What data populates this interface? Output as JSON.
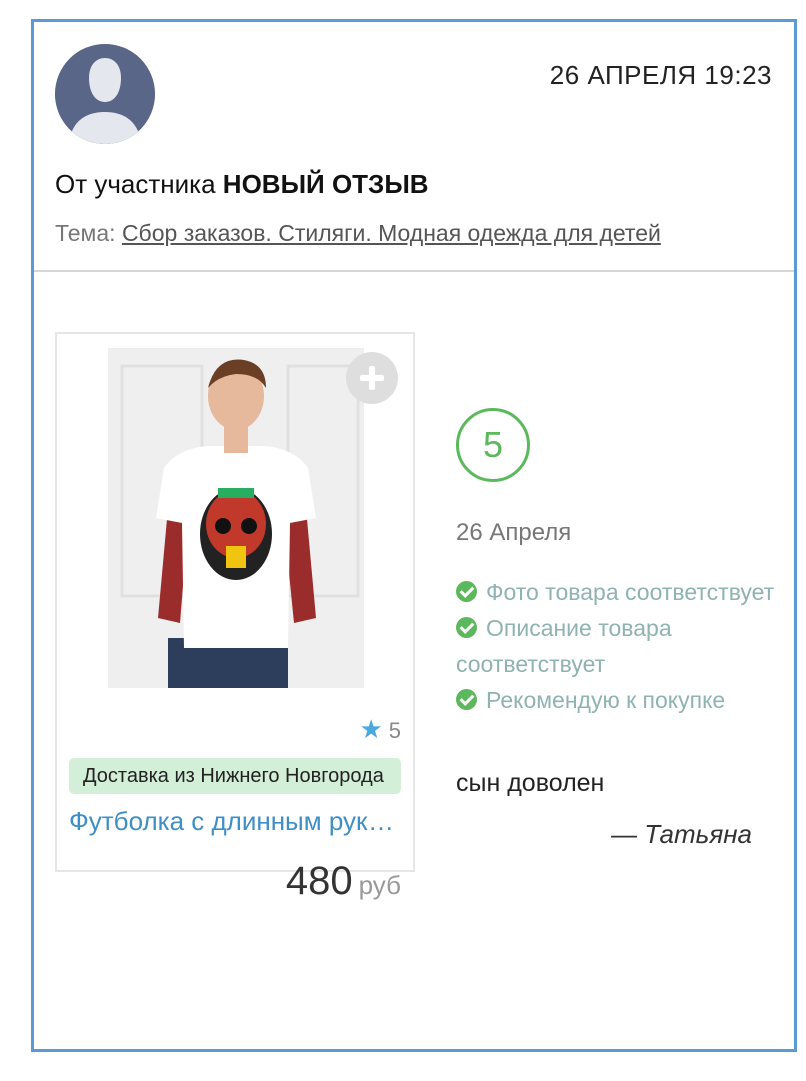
{
  "header": {
    "date": "26 АПРЕЛЯ 19:23",
    "from_prefix": "От участника",
    "from_name": "НОВЫЙ ОТЗЫВ",
    "topic_label": "Тема:",
    "topic_link": "Сбор заказов. Стиляги. Модная одежда для детей"
  },
  "product": {
    "rating_count": "5",
    "delivery": "Доставка из Нижнего Новгорода",
    "name": "Футболка с длинным рукавом",
    "price": "480",
    "currency": "руб"
  },
  "review": {
    "rating": "5",
    "date": "26 Апреля",
    "checks": [
      "Фото товара соответствует",
      "Описание товара соответствует",
      "Рекомендую к покупке"
    ],
    "comment": "сын доволен",
    "author": "— Татьяна"
  },
  "colors": {
    "border": "#5b9bd5",
    "accent_green": "#5cb85c",
    "link_blue": "#3f8fc6",
    "delivery_bg": "#d4efd8"
  },
  "icons": [
    "user-avatar-icon",
    "add-icon",
    "star-icon",
    "check-circle-icon"
  ]
}
